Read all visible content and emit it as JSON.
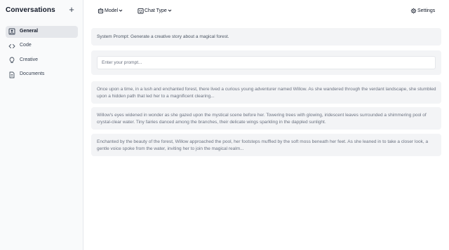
{
  "sidebar": {
    "title": "Conversations",
    "new_button": "+",
    "items": [
      {
        "label": "General",
        "icon": "portrait-icon",
        "active": true
      },
      {
        "label": "Code",
        "icon": "code-icon",
        "active": false
      },
      {
        "label": "Creative",
        "icon": "lightbulb-icon",
        "active": false
      },
      {
        "label": "Documents",
        "icon": "document-icon",
        "active": false
      }
    ]
  },
  "toolbar": {
    "model_label": "Model",
    "chat_type_label": "Chat Type",
    "settings_label": "Settings"
  },
  "main": {
    "system_prompt": "System Prompt: Generate a creative story about a magical forest.",
    "prompt_placeholder": "Enter your prompt...",
    "messages": [
      {
        "text": "Once upon a time, in a lush and enchanted forest, there lived a curious young adventurer named Willow. As she wandered through the verdant landscape, she stumbled upon a hidden path that led her to a magnificent clearing..."
      },
      {
        "text": "Willow's eyes widened in wonder as she gazed upon the mystical scene before her. Towering trees with glowing, iridescent leaves surrounded a shimmering pool of crystal-clear water. Tiny fairies danced among the branches, their delicate wings sparkling in the dappled sunlight."
      },
      {
        "text": "Enchanted by the beauty of the forest, Willow approached the pool, her footsteps muffled by the soft moss beneath her feet. As she leaned in to take a closer look, a gentle voice spoke from the water, inviting her to join the magical realm..."
      }
    ]
  }
}
